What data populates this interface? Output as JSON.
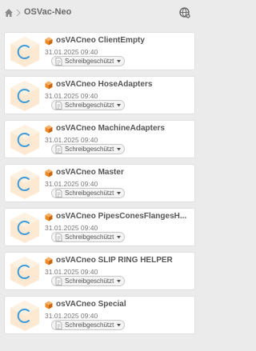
{
  "header": {
    "breadcrumb_title": "OSVac-Neo",
    "home_icon": "home-icon",
    "separator_icon": "chevron-right-icon",
    "globe_icon": "globe-icon"
  },
  "items": [
    {
      "title": "osVACneo ClientEmpty",
      "date": "31.01.2025 09:40",
      "status": "Schreibgeschützt"
    },
    {
      "title": "osVACneo HoseAdapters",
      "date": "31.01.2025 09:40",
      "status": "Schreibgeschützt"
    },
    {
      "title": "osVACneo MachineAdapters",
      "date": "31.01.2025 09:40",
      "status": "Schreibgeschützt"
    },
    {
      "title": "osVACneo Master",
      "date": "31.01.2025 09:40",
      "status": "Schreibgeschützt"
    },
    {
      "title": "osVACneo PipesConesFlangesH...",
      "date": "31.01.2025 09:40",
      "status": "Schreibgeschützt"
    },
    {
      "title": "osVACneo SLIP RING HELPER",
      "date": "31.01.2025 09:40",
      "status": "Schreibgeschützt"
    },
    {
      "title": "osVACneo Special",
      "date": "31.01.2025 09:40",
      "status": "Schreibgeschützt"
    }
  ],
  "colors": {
    "background": "#ebebeb",
    "cube_orange": "#f08a24",
    "thumb_blue": "#3f9bd8",
    "thumb_peach": "#fde9d2"
  }
}
